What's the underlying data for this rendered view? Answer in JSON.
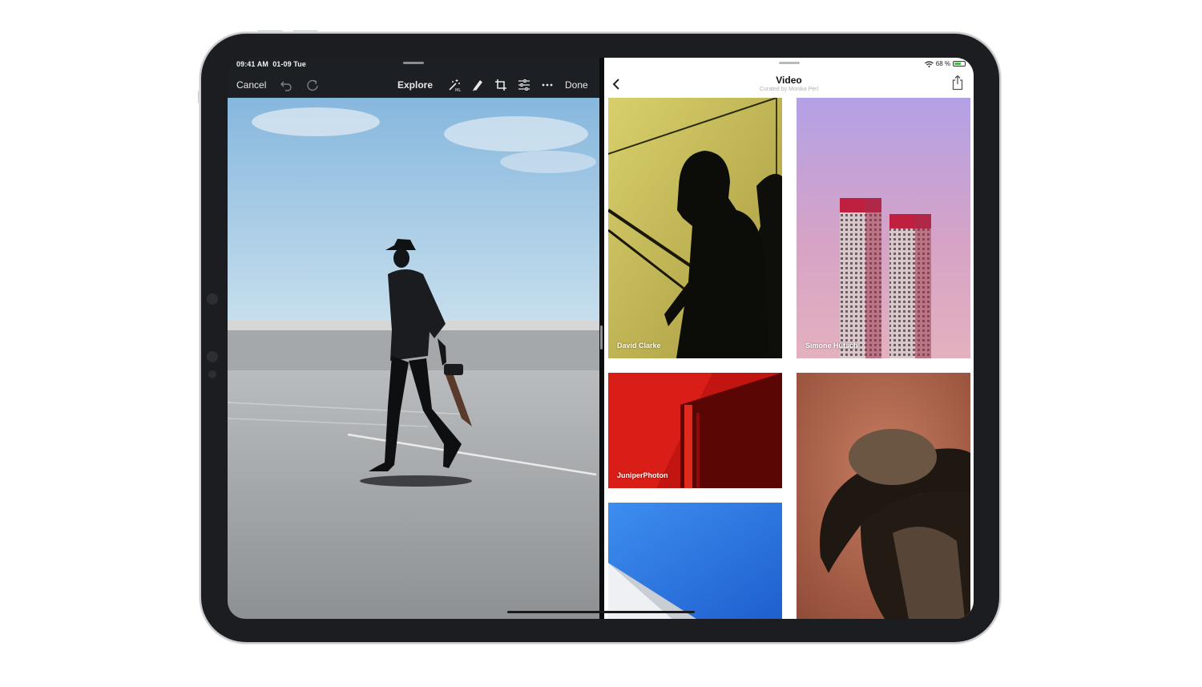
{
  "status_bar": {
    "time": "09:41 AM",
    "date": "01-09 Tue",
    "battery_percent": "68 %",
    "battery_level": 0.68
  },
  "editor": {
    "cancel_label": "Cancel",
    "title": "Explore",
    "done_label": "Done",
    "icons": [
      "undo-icon",
      "redo-icon",
      "magic-wand-icon",
      "brush-icon",
      "crop-icon",
      "adjust-sliders-icon",
      "more-icon"
    ]
  },
  "collection": {
    "title": "Video",
    "subtitle": "Curated by Monika Perl",
    "photos": [
      {
        "credit": "David Clarke"
      },
      {
        "credit": "Simone Hutsch"
      },
      {
        "credit": "JuniperPhoton"
      },
      {
        "credit": ""
      },
      {
        "credit": ""
      }
    ]
  },
  "colors": {
    "editor_bg": "#1c1f23",
    "sky": "#9ec6e2",
    "wall_yellow": "#c9c05a",
    "sunset_pink": "#d6a5c4",
    "red_wall": "#b81612",
    "blue_sky": "#2e7fe0",
    "terracotta": "#b56a4f"
  }
}
